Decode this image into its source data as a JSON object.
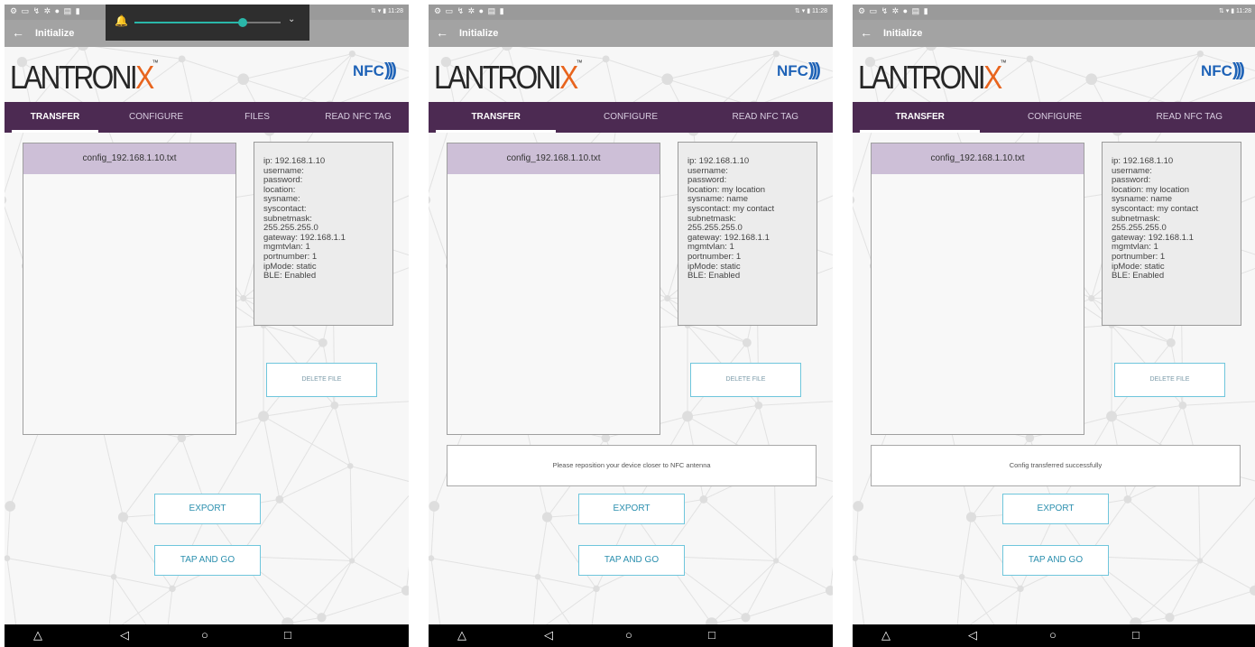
{
  "app": {
    "title": "Initialize"
  },
  "brand": {
    "logo_prefix": "LANTRONI",
    "logo_x": "X",
    "logo_tm": "™",
    "nfc_label": "NFC",
    "nfc_waves": ")))"
  },
  "status_bar": {
    "left_icons": "⚙ ▭ ↯ ✲ ● ▤ ▮",
    "right_text": "⇅ ▾ ▮ 11:28"
  },
  "volume": {
    "level": 0.74,
    "bell": "🔔",
    "chevron": "⌄"
  },
  "icons": {
    "back": "←",
    "nav_back": "◁",
    "nav_home": "○",
    "nav_recent": "□",
    "nav_hide": "△"
  },
  "screens": [
    {
      "tabs": [
        "TRANSFER",
        "CONFIGURE",
        "FILES",
        "READ NFC TAG"
      ],
      "active_tab": 0,
      "file_name": "config_192.168.1.10.txt",
      "info": "ip: 192.168.1.10\nusername:\npassword:\nlocation:\nsysname:\nsyscontact:\nsubnetmask:\n255.255.255.0\ngateway: 192.168.1.1\nmgmtvlan: 1\nportnumber: 1\nipMode: static\nBLE: Enabled",
      "delete_label": "DELETE FILE",
      "message": "",
      "export_label": "EXPORT",
      "tap_label": "TAP AND GO",
      "volume_popup": true
    },
    {
      "tabs": [
        "TRANSFER",
        "CONFIGURE",
        "READ NFC TAG"
      ],
      "active_tab": 0,
      "file_name": "config_192.168.1.10.txt",
      "info": "ip: 192.168.1.10\nusername:\npassword:\nlocation: my location\nsysname: name\nsyscontact: my contact\nsubnetmask:\n255.255.255.0\ngateway: 192.168.1.1\nmgmtvlan: 1\nportnumber: 1\nipMode: static\nBLE: Enabled",
      "delete_label": "DELETE FILE",
      "message": "Please reposition your device closer to NFC antenna",
      "export_label": "EXPORT",
      "tap_label": "TAP AND GO",
      "volume_popup": false
    },
    {
      "tabs": [
        "TRANSFER",
        "CONFIGURE",
        "READ NFC TAG"
      ],
      "active_tab": 0,
      "file_name": "config_192.168.1.10.txt",
      "info": "ip: 192.168.1.10\nusername:\npassword:\nlocation: my location\nsysname: name\nsyscontact: my contact\nsubnetmask:\n255.255.255.0\ngateway: 192.168.1.1\nmgmtvlan: 1\nportnumber: 1\nipMode: static\nBLE: Enabled",
      "delete_label": "DELETE FILE",
      "message": "Config transferred successfully",
      "export_label": "EXPORT",
      "tap_label": "TAP AND GO",
      "volume_popup": false
    }
  ]
}
